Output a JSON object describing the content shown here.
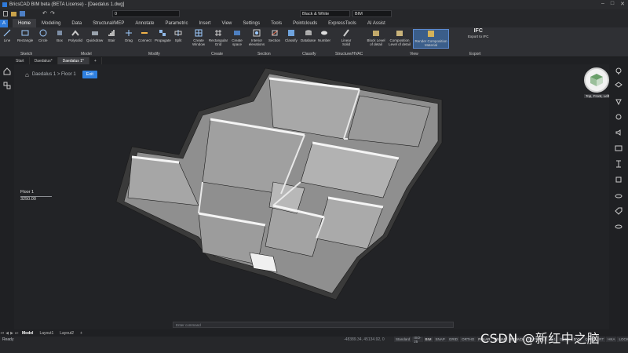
{
  "window": {
    "title": "BricsCAD BIM beta (BETA License) - [Daedalus 1.dwg]"
  },
  "quick_access": {
    "layer_value": "0",
    "visual_style": "Black & White",
    "workspace": "BIM"
  },
  "ribbon_tabs": [
    "Home",
    "Modeling",
    "Data",
    "Structural/MEP",
    "Annotate",
    "Parametric",
    "Insert",
    "View",
    "Settings",
    "Tools",
    "Pointclouds",
    "ExpressTools",
    "AI Assist"
  ],
  "ribbon": {
    "sketch": [
      "Line",
      "Rectangle",
      "Circle"
    ],
    "model": [
      "Box",
      "Polysolid",
      "Quickdraw",
      "Stair"
    ],
    "modify": [
      "Drag",
      "Connect",
      "Propagate",
      "Split"
    ],
    "create": [
      "Create Window",
      "Rectangular Grid",
      "Create space"
    ],
    "section": [
      "Interior elevations",
      "Section"
    ],
    "classify": [
      "Classify",
      "Database",
      "Number"
    ],
    "structure": [
      "Linear Solid"
    ],
    "view": [
      "Block Level of detail",
      "Composition Level of detail",
      "Render Composition Material"
    ],
    "export": [
      "IFC",
      "Export to IFC"
    ],
    "group_labels": [
      "Sketch",
      "Model",
      "Modify",
      "Create",
      "Section",
      "Classify",
      "Structure/HVAC",
      "View",
      "Export"
    ]
  },
  "doc_tabs": [
    "Start",
    "Daedalus*",
    "Daedalus 1*"
  ],
  "viewport": {
    "breadcrumb": "Daedalus 1 > Floor 1",
    "exit_label": "Exit",
    "floor_name": "Floor 1",
    "floor_elevation": "3250.00",
    "viewcube_label": "Top, Front, Left",
    "command_placeholder": "Enter command"
  },
  "layout_tabs": [
    "Model",
    "Layout1",
    "Layout2"
  ],
  "status": {
    "ready": "Ready",
    "coords": "-48389.34, 45134.92, 0",
    "items": [
      "Standard",
      "ISO-25",
      "BIM",
      "SNAP",
      "GRID",
      "ORTHO",
      "POLAR",
      "ESNAP",
      "STRACK",
      "LWT",
      "TILE",
      "1:1",
      "DUCS",
      "DYN",
      "QUAD",
      "RT",
      "HKA",
      "LOCKUI",
      "None"
    ]
  },
  "watermark": "CSDN @新红中之脑"
}
